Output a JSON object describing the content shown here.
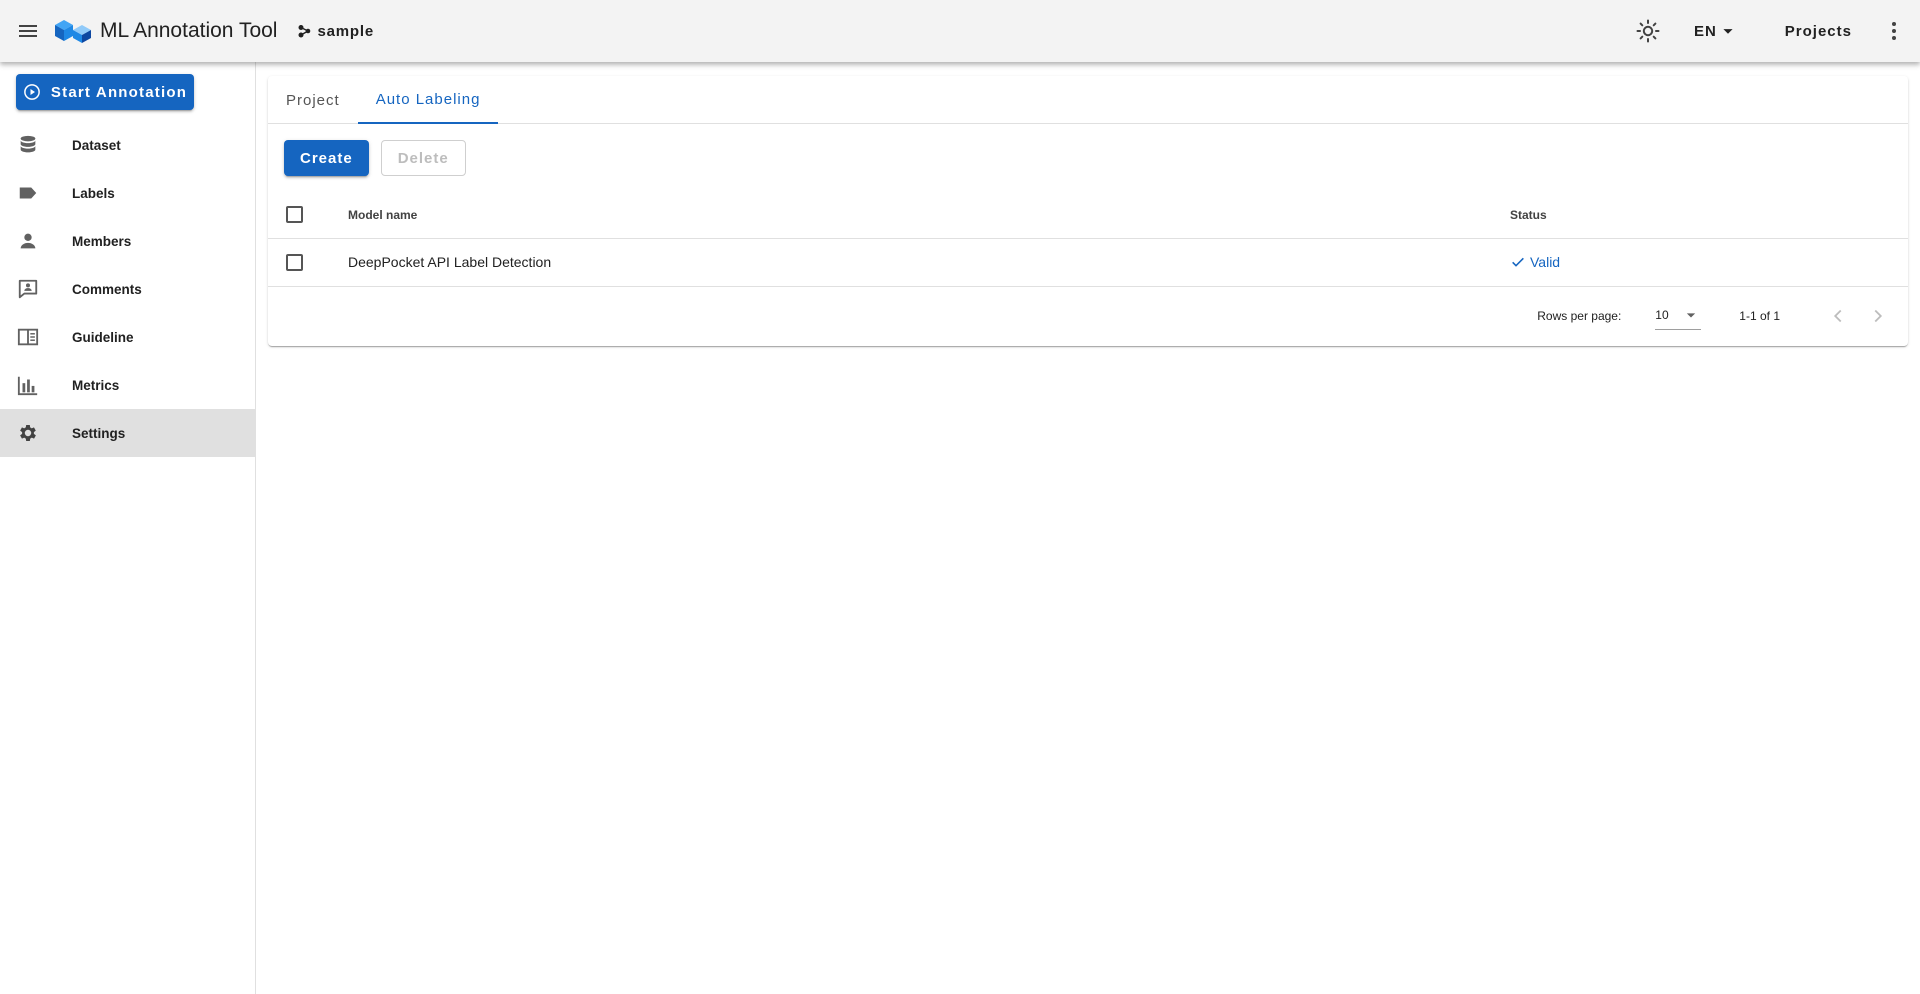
{
  "app": {
    "title": "ML Annotation Tool",
    "project_name": "sample",
    "language": "EN",
    "projects_label": "Projects"
  },
  "sidebar": {
    "start_button": "Start Annotation",
    "items": [
      {
        "label": "Dataset",
        "icon": "database-icon"
      },
      {
        "label": "Labels",
        "icon": "label-icon"
      },
      {
        "label": "Members",
        "icon": "person-icon"
      },
      {
        "label": "Comments",
        "icon": "comment-account-icon"
      },
      {
        "label": "Guideline",
        "icon": "book-open-icon"
      },
      {
        "label": "Metrics",
        "icon": "chart-bar-icon"
      },
      {
        "label": "Settings",
        "icon": "gear-icon",
        "active": true
      }
    ]
  },
  "tabs": [
    {
      "label": "Project"
    },
    {
      "label": "Auto Labeling",
      "active": true
    }
  ],
  "toolbar": {
    "create_label": "Create",
    "delete_label": "Delete"
  },
  "table": {
    "columns": [
      "Model name",
      "Status"
    ],
    "rows": [
      {
        "model_name": "DeepPocket API Label Detection",
        "status": "Valid"
      }
    ]
  },
  "pagination": {
    "rows_per_page_label": "Rows per page:",
    "rows_per_page_value": "10",
    "range_text": "1-1 of 1"
  },
  "colors": {
    "primary": "#1565c0",
    "appbar_bg": "#f3f3f3",
    "active_nav_bg": "#e0e0e0"
  }
}
